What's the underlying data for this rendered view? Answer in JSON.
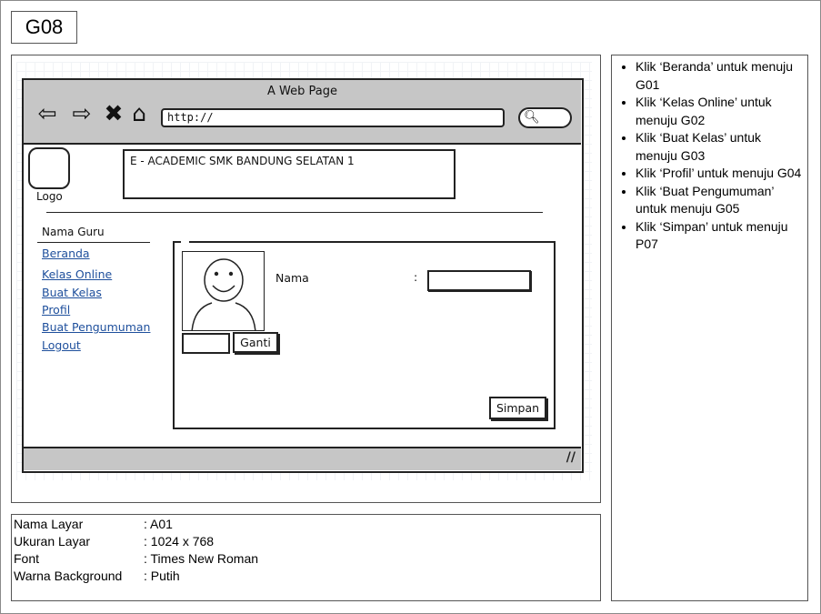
{
  "screen_code": "G08",
  "mockup": {
    "browser_title": "A Web Page",
    "url": "http://",
    "nav_icons": [
      "back-arrow-icon",
      "forward-arrow-icon",
      "close-x-icon",
      "home-icon"
    ],
    "logo_label": "Logo",
    "banner_text": "E - ACADEMIC SMK BANDUNG SELATAN 1",
    "sidebar": {
      "heading": "Nama Guru",
      "links": [
        "Beranda",
        "Kelas Online",
        "Buat Kelas",
        "Profil",
        "Buat Pengumuman",
        "Logout"
      ]
    },
    "form": {
      "ganti_label": "Ganti",
      "nama_label": "Nama",
      "colon": ":",
      "simpan_label": "Simpan"
    }
  },
  "info": {
    "rows": [
      {
        "label": "Nama Layar",
        "value": ": A01"
      },
      {
        "label": "Ukuran Layar",
        "value": ": 1024 x 768"
      },
      {
        "label": "Font",
        "value": ": Times New Roman"
      },
      {
        "label": "Warna Background",
        "value": ": Putih"
      }
    ]
  },
  "notes": [
    "Klik ‘Beranda’ untuk menuju G01",
    "Klik ‘Kelas Online’ untuk menuju G02",
    "Klik ‘Buat Kelas’ untuk menuju G03",
    "Klik ‘Profil’ untuk menuju G04",
    "Klik ‘Buat Pengumuman’ untuk menuju G05",
    "Klik ‘Simpan’ untuk menuju P07"
  ]
}
